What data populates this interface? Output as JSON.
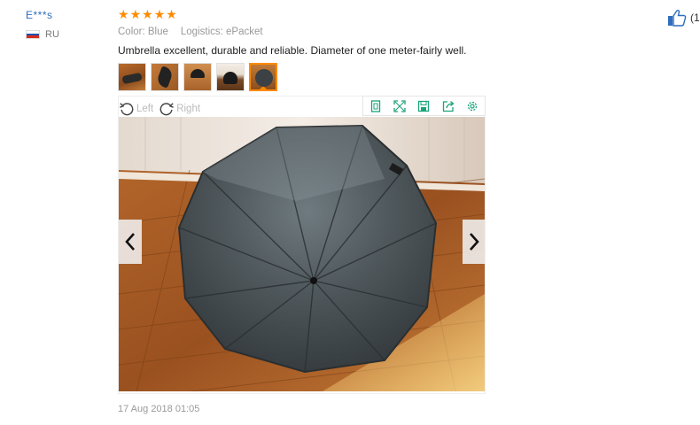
{
  "review": {
    "user": {
      "name": "E***s",
      "country_code": "RU",
      "flag_icon": "russia-flag-icon"
    },
    "rating": {
      "stars": 5,
      "max": 5,
      "star_glyph": "★",
      "star_color": "#ff8a00"
    },
    "meta": {
      "color": "Color: Blue",
      "logistics": "Logistics: ePacket"
    },
    "text": "Umbrella excellent, durable and reliable. Diameter of one meter-fairly well.",
    "thumbnails_count": 5,
    "active_thumbnail_index": 5,
    "viewer": {
      "rotate_left_label": "Left",
      "rotate_right_label": "Right",
      "tools": [
        "fit-screen-icon",
        "fullscreen-icon",
        "save-icon",
        "share-icon",
        "settings-icon"
      ],
      "tool_color": "#1aa37a"
    },
    "date": "17 Aug 2018 01:05",
    "helpful": {
      "count_text": "(1",
      "icon": "thumbs-up-icon",
      "icon_color": "#2f6dbf"
    }
  }
}
